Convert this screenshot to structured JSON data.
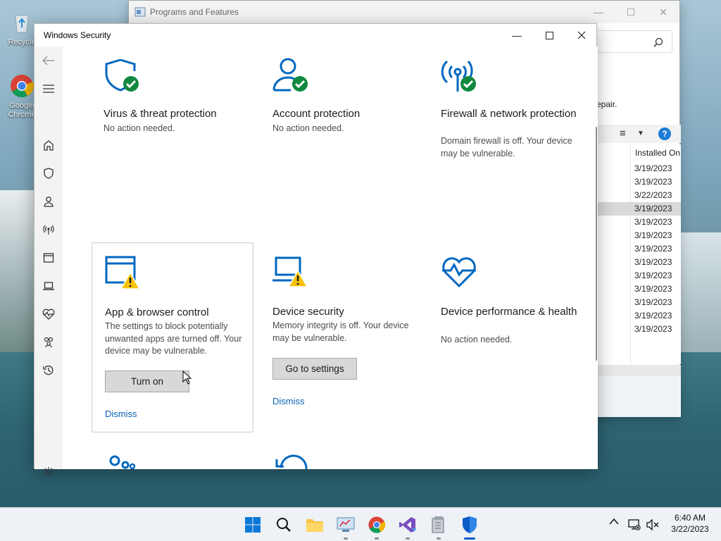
{
  "desktop": {
    "icons": [
      {
        "label": "Recycle",
        "name": "recycle-bin"
      },
      {
        "label": "Google Chrome",
        "name": "google-chrome"
      }
    ]
  },
  "programs_features": {
    "title": "Programs and Features",
    "repair_text": "epair.",
    "column_header": "Installed On",
    "dates": [
      "3/19/2023",
      "3/19/2023",
      "3/22/2023",
      "3/19/2023",
      "3/19/2023",
      "3/19/2023",
      "3/19/2023",
      "3/19/2023",
      "3/19/2023",
      "3/19/2023",
      "3/19/2023",
      "3/19/2023",
      "3/19/2023"
    ],
    "selected_row_index": 3,
    "help_label": "?"
  },
  "security_window": {
    "title": "Windows Security",
    "nav_items": [
      "back-arrow-icon",
      "hamburger-menu-icon",
      "home-icon",
      "shield-icon",
      "account-icon",
      "network-icon",
      "app-browser-icon",
      "device-icon",
      "health-icon",
      "family-icon",
      "history-icon",
      "settings-icon"
    ],
    "cards": [
      {
        "id": "virus",
        "title": "Virus & threat protection",
        "desc": "No action needed.",
        "status": "ok",
        "icon": "shield-check-icon"
      },
      {
        "id": "account",
        "title": "Account protection",
        "desc": "No action needed.",
        "status": "ok",
        "icon": "account-check-icon"
      },
      {
        "id": "firewall",
        "title": "Firewall & network protection",
        "desc": "Domain firewall is off. Your device may be vulnerable.",
        "status": "ok",
        "icon": "wifi-check-icon"
      },
      {
        "id": "app",
        "title": "App & browser control",
        "desc": "The settings to block potentially unwanted apps are turned off. Your device may be vulnerable.",
        "button": "Turn on",
        "link": "Dismiss",
        "status": "warning",
        "icon": "browser-warning-icon"
      },
      {
        "id": "device",
        "title": "Device security",
        "desc": "Memory integrity is off. Your device may be vulnerable.",
        "button": "Go to settings",
        "link": "Dismiss",
        "status": "warning",
        "icon": "laptop-warning-icon"
      },
      {
        "id": "health",
        "title": "Device performance & health",
        "desc": "No action needed.",
        "status": "ok",
        "icon": "heart-pulse-icon"
      }
    ]
  },
  "taskbar": {
    "apps": [
      "start",
      "search",
      "file-explorer",
      "control-panel",
      "chrome",
      "visual-studio",
      "installer",
      "windows-security"
    ],
    "time": "6:40 AM",
    "date": "3/22/2023"
  },
  "colors": {
    "accent": "#0067c0",
    "ok": "#10893e",
    "warning": "#f8c200"
  }
}
